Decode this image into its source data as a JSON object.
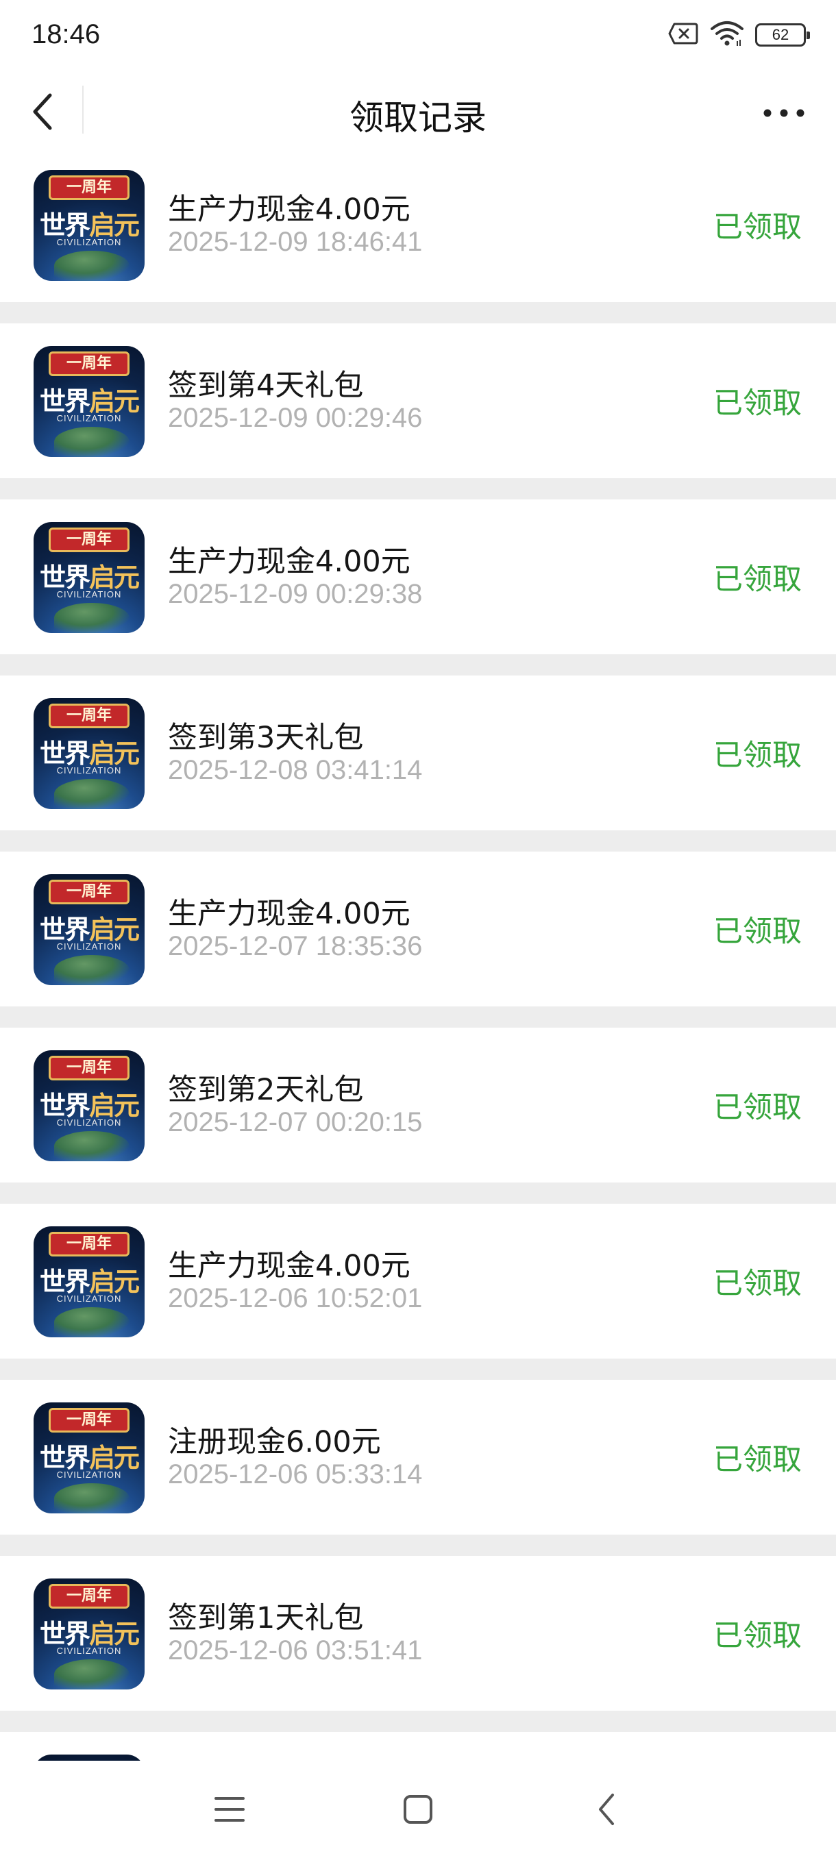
{
  "status_bar": {
    "time": "18:46",
    "battery": "62",
    "icons": [
      "sim-error-icon",
      "wifi-icon",
      "battery-icon"
    ]
  },
  "header": {
    "title": "领取记录",
    "back_icon": "chevron-left-icon",
    "more_icon": "more-dots-icon"
  },
  "app_icon": {
    "banner": "一周年",
    "title_a": "世界",
    "title_b": "启元",
    "subtitle": "CIVILIZATION"
  },
  "colors": {
    "status_green": "#36a53c",
    "time_gray": "#b2b2b2",
    "background": "#ededed"
  },
  "records": [
    {
      "title": "生产力现金4.00元",
      "time": "2025-12-09 18:46:41",
      "status": "已领取"
    },
    {
      "title": "签到第4天礼包",
      "time": "2025-12-09 00:29:46",
      "status": "已领取"
    },
    {
      "title": "生产力现金4.00元",
      "time": "2025-12-09 00:29:38",
      "status": "已领取"
    },
    {
      "title": "签到第3天礼包",
      "time": "2025-12-08 03:41:14",
      "status": "已领取"
    },
    {
      "title": "生产力现金4.00元",
      "time": "2025-12-07 18:35:36",
      "status": "已领取"
    },
    {
      "title": "签到第2天礼包",
      "time": "2025-12-07 00:20:15",
      "status": "已领取"
    },
    {
      "title": "生产力现金4.00元",
      "time": "2025-12-06 10:52:01",
      "status": "已领取"
    },
    {
      "title": "注册现金6.00元",
      "time": "2025-12-06 05:33:14",
      "status": "已领取"
    },
    {
      "title": "签到第1天礼包",
      "time": "2025-12-06 03:51:41",
      "status": "已领取"
    }
  ],
  "system_nav": {
    "icons": [
      "menu-icon",
      "home-icon",
      "back-icon"
    ]
  }
}
